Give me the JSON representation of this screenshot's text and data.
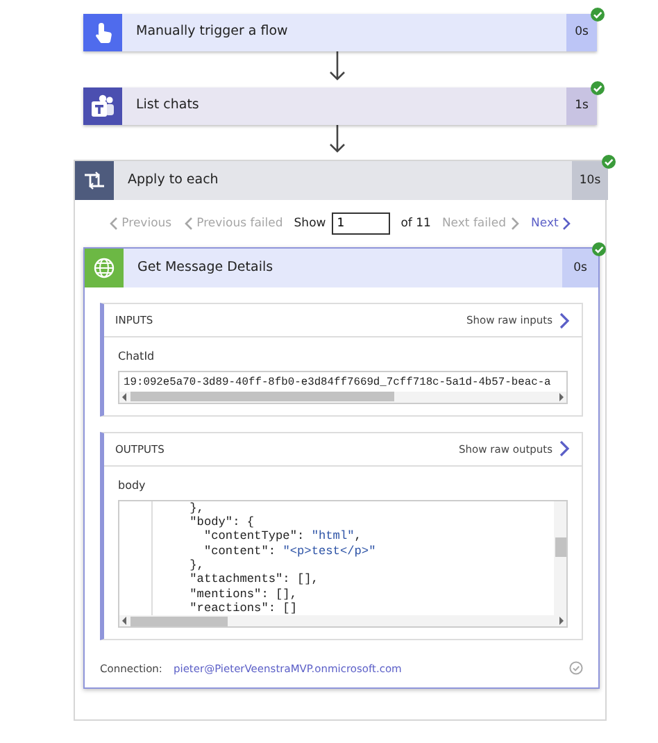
{
  "steps": [
    {
      "kind": "trigger",
      "title": "Manually trigger a flow",
      "duration": "0s",
      "succeeded": true
    },
    {
      "kind": "teams",
      "title": "List chats",
      "duration": "1s",
      "succeeded": true
    }
  ],
  "loop": {
    "kind": "loop",
    "title": "Apply to each",
    "duration": "10s",
    "succeeded": true,
    "pager": [
      {
        "kind": "back",
        "label": "Previous",
        "disabled": true
      },
      {
        "kind": "back",
        "label": "Previous failed",
        "disabled": true
      },
      {
        "kind": "show",
        "label": "Show",
        "value": "1"
      },
      {
        "kind": "text",
        "label": "of 11"
      },
      {
        "kind": "forward",
        "label": "Next failed",
        "disabled": true
      },
      {
        "kind": "forward",
        "label": "Next",
        "disabled": false
      }
    ],
    "action": {
      "kind": "http",
      "title": "Get Message Details",
      "duration": "0s",
      "succeeded": true,
      "sections": [
        {
          "heading": "INPUTS",
          "raw_link": "Show raw inputs",
          "field": {
            "kind": "value",
            "label": "ChatId",
            "value": "19:092e5a70-3d89-40ff-8fb0-e3d84ff7669d_7cff718c-5a1d-4b57-beac-a"
          }
        },
        {
          "heading": "OUTPUTS",
          "raw_link": "Show raw outputs",
          "field": {
            "kind": "code",
            "label": "body",
            "lines": [
              [
                {
                  "kind": "punct",
                  "text": "    },"
                }
              ],
              [
                {
                  "kind": "key",
                  "text": "    \"body\""
                },
                {
                  "kind": "punct",
                  "text": ": {"
                }
              ],
              [
                {
                  "kind": "key",
                  "text": "      \"contentType\""
                },
                {
                  "kind": "punct",
                  "text": ": "
                },
                {
                  "kind": "string",
                  "text": "\"html\""
                },
                {
                  "kind": "punct",
                  "text": ","
                }
              ],
              [
                {
                  "kind": "key",
                  "text": "      \"content\""
                },
                {
                  "kind": "punct",
                  "text": ": "
                },
                {
                  "kind": "string",
                  "text": "\"<p>test</p>\""
                }
              ],
              [
                {
                  "kind": "punct",
                  "text": "    },"
                }
              ],
              [
                {
                  "kind": "key",
                  "text": "    \"attachments\""
                },
                {
                  "kind": "punct",
                  "text": ": [],"
                }
              ],
              [
                {
                  "kind": "key",
                  "text": "    \"mentions\""
                },
                {
                  "kind": "punct",
                  "text": ": [],"
                }
              ],
              [
                {
                  "kind": "key",
                  "text": "    \"reactions\""
                },
                {
                  "kind": "punct",
                  "text": ": []"
                }
              ]
            ]
          }
        }
      ],
      "connection": {
        "label": "Connection:",
        "account": "pieter@PieterVeenstraMVP.onmicrosoft.com"
      }
    }
  }
}
